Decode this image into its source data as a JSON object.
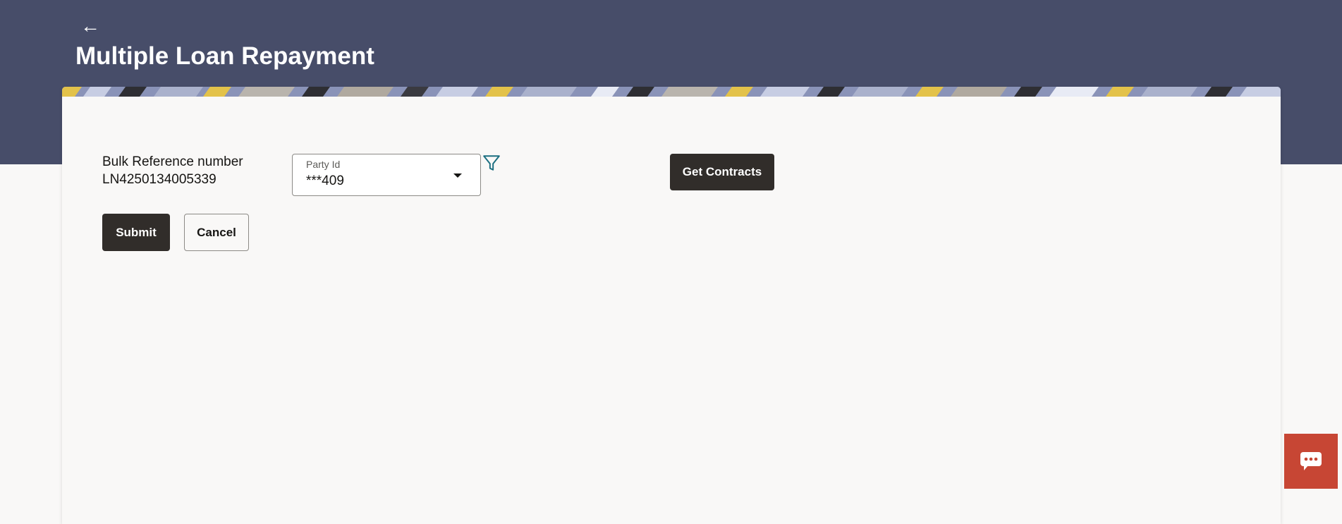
{
  "header": {
    "back_icon": "arrow-left-icon",
    "title": "Multiple Loan Repayment",
    "background_color": "#474d69"
  },
  "form": {
    "bulk_reference_label": "Bulk Reference number",
    "bulk_reference_value": "LN4250134005339",
    "party_id": {
      "label": "Party Id",
      "value": "***409",
      "icon": "chevron-down-icon"
    },
    "filter_icon": "filter-icon",
    "filter_icon_color": "#1b6e80",
    "get_contracts_label": "Get Contracts"
  },
  "actions": {
    "submit_label": "Submit",
    "cancel_label": "Cancel",
    "primary_color": "#312d2a"
  },
  "chat": {
    "icon": "chat-bubble-icon",
    "color": "#c74634"
  }
}
